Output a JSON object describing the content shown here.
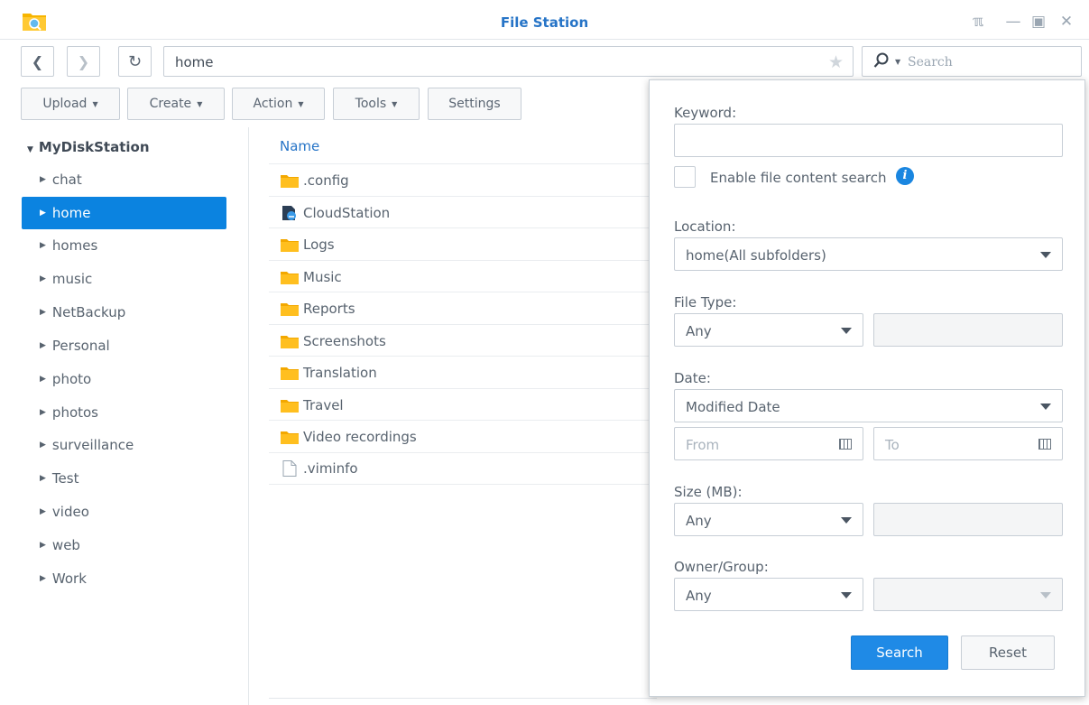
{
  "window": {
    "title": "File Station",
    "colors": {
      "accent": "#2674c7",
      "selected": "#0b83e0",
      "folder": "#f7b500",
      "primary_button": "#1f8ae6"
    }
  },
  "nav": {
    "path": "home",
    "search_placeholder": "Search"
  },
  "toolbar": {
    "upload": "Upload",
    "create": "Create",
    "action": "Action",
    "tools": "Tools",
    "settings": "Settings"
  },
  "sidebar": {
    "root": "MyDiskStation",
    "items": [
      {
        "label": "chat"
      },
      {
        "label": "home",
        "selected": true
      },
      {
        "label": "homes"
      },
      {
        "label": "music"
      },
      {
        "label": "NetBackup"
      },
      {
        "label": "Personal"
      },
      {
        "label": "photo"
      },
      {
        "label": "photos"
      },
      {
        "label": "surveillance"
      },
      {
        "label": "Test"
      },
      {
        "label": "video"
      },
      {
        "label": "web"
      },
      {
        "label": "Work"
      }
    ]
  },
  "filelist": {
    "column_name": "Name",
    "rows": [
      {
        "name": ".config",
        "icon": "folder-icon"
      },
      {
        "name": "CloudStation",
        "icon": "cloudstation-icon"
      },
      {
        "name": "Logs",
        "icon": "folder-icon"
      },
      {
        "name": "Music",
        "icon": "folder-icon"
      },
      {
        "name": "Reports",
        "icon": "folder-icon"
      },
      {
        "name": "Screenshots",
        "icon": "folder-icon"
      },
      {
        "name": "Translation",
        "icon": "folder-icon"
      },
      {
        "name": "Travel",
        "icon": "folder-icon"
      },
      {
        "name": "Video recordings",
        "icon": "folder-icon"
      },
      {
        "name": ".viminfo",
        "icon": "file-icon"
      }
    ]
  },
  "search_panel": {
    "keyword_label": "Keyword:",
    "keyword_value": "",
    "content_search_label": "Enable file content search",
    "location_label": "Location:",
    "location_value": "home(All subfolders)",
    "file_type_label": "File Type:",
    "file_type_value": "Any",
    "date_label": "Date:",
    "date_value": "Modified Date",
    "from_placeholder": "From",
    "to_placeholder": "To",
    "size_label": "Size (MB):",
    "size_value": "Any",
    "owner_label": "Owner/Group:",
    "owner_value": "Any",
    "search_button": "Search",
    "reset_button": "Reset"
  }
}
